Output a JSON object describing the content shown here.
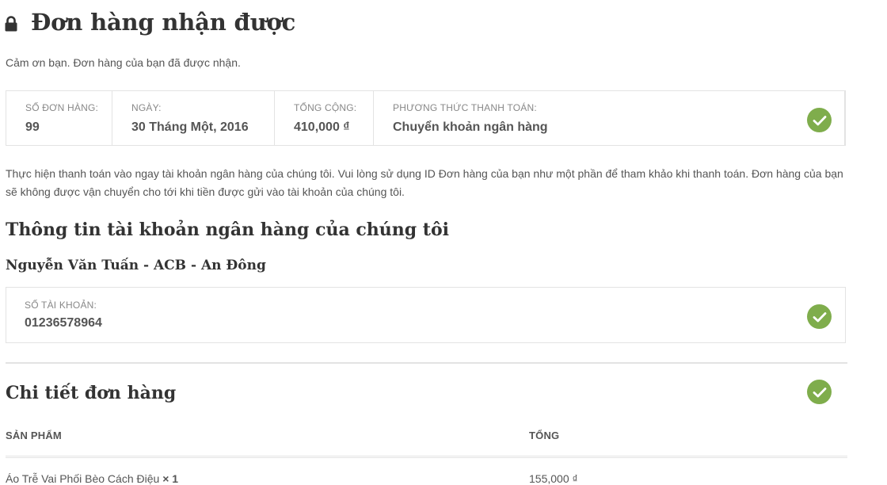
{
  "header": {
    "lock_icon": "lock-icon",
    "title": "Đơn hàng nhận được"
  },
  "thanks_message": "Cảm ơn bạn. Đơn hàng của bạn đã được nhận.",
  "order_overview": {
    "order_number_label": "SỐ ĐƠN HÀNG:",
    "order_number": "99",
    "date_label": "NGÀY:",
    "date": "30 Tháng Một, 2016",
    "total_label": "TỔNG CỘNG:",
    "total": "410,000 ₫",
    "payment_method_label": "PHƯƠNG THỨC THANH TOÁN:",
    "payment_method": "Chuyển khoản ngân hàng"
  },
  "payment_instructions": "Thực hiện thanh toán vào ngay tài khoản ngân hàng của chúng tôi. Vui lòng sử dụng ID Đơn hàng của bạn như một phần để tham khảo khi thanh toán. Đơn hàng của bạn sẽ không được vận chuyển cho tới khi tiền được gửi vào tài khoản của chúng tôi.",
  "bank_details": {
    "heading": "Thông tin tài khoản ngân hàng của chúng tôi",
    "bank_name": "Nguyễn Văn Tuấn - ACB - An Đông",
    "account_number_label": "SỐ TÀI KHOẢN:",
    "account_number": "01236578964"
  },
  "order_details": {
    "heading": "Chi tiết đơn hàng",
    "columns": [
      "SẢN PHẨM",
      "TỔNG"
    ],
    "rows": [
      {
        "product": "Áo Trễ Vai Phối Bèo Cách Điệu",
        "qty": "× 1",
        "total": "155,000 ₫"
      }
    ]
  },
  "colors": {
    "check_green": "#7fad4c",
    "border": "#e3e3e3",
    "text": "#555555",
    "heading": "#333333"
  }
}
